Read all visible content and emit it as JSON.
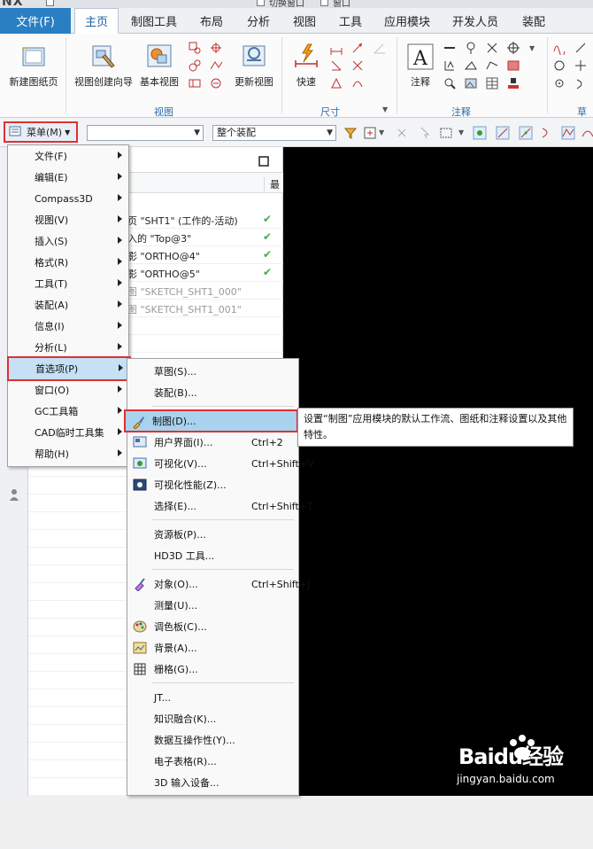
{
  "titlebar": {
    "app_logo": "NX",
    "items": [
      "切换窗口",
      "窗口"
    ]
  },
  "ribbon": {
    "file_tab": "文件(F)",
    "tabs": [
      "主页",
      "制图工具",
      "布局",
      "分析",
      "视图",
      "工具",
      "应用模块",
      "开发人员",
      "装配"
    ],
    "active_tab": "主页",
    "buttons": {
      "new_sheet": "新建图纸页",
      "view_wizard": "视图创建向导",
      "base_view": "基本视图",
      "update_view": "更新视图",
      "quick": "快速",
      "annotation": "注释"
    },
    "groups": {
      "view": "视图",
      "dimension": "尺寸",
      "annotation": "注释",
      "sketch": "草图"
    }
  },
  "commandbar": {
    "menu_button": "菜单(M)",
    "filter_combo": "",
    "assembly_combo": "整个装配"
  },
  "navigator": {
    "rows": [
      {
        "text": "页 \"SHT1\" (工作的-活动)",
        "check": true,
        "dim": false
      },
      {
        "text": "入的 \"Top@3\"",
        "check": true,
        "dim": false
      },
      {
        "text": "影 \"ORTHO@4\"",
        "check": true,
        "dim": false
      },
      {
        "text": "影 \"ORTHO@5\"",
        "check": true,
        "dim": false
      },
      {
        "text": "图 \"SKETCH_SHT1_000\"",
        "check": false,
        "dim": true
      },
      {
        "text": "图 \"SKETCH_SHT1_001\"",
        "check": false,
        "dim": true
      }
    ],
    "column_header": "最"
  },
  "mainmenu": {
    "items": [
      {
        "label": "文件(F)",
        "submenu": true
      },
      {
        "label": "编辑(E)",
        "submenu": true
      },
      {
        "label": "Compass3D",
        "submenu": true
      },
      {
        "label": "视图(V)",
        "submenu": true
      },
      {
        "label": "插入(S)",
        "submenu": true
      },
      {
        "label": "格式(R)",
        "submenu": true
      },
      {
        "label": "工具(T)",
        "submenu": true
      },
      {
        "label": "装配(A)",
        "submenu": true
      },
      {
        "label": "信息(I)",
        "submenu": true
      },
      {
        "label": "分析(L)",
        "submenu": true
      },
      {
        "label": "首选项(P)",
        "submenu": true,
        "highlight": true
      },
      {
        "label": "窗口(O)",
        "submenu": true
      },
      {
        "label": "GC工具箱",
        "submenu": true
      },
      {
        "label": "CAD临时工具集",
        "submenu": true
      },
      {
        "label": "帮助(H)",
        "submenu": true
      }
    ]
  },
  "submenu": {
    "items": [
      {
        "label": "草图(S)...",
        "shortcut": "",
        "icon": ""
      },
      {
        "label": "装配(B)...",
        "shortcut": "",
        "icon": ""
      },
      {
        "label": "制图(D)...",
        "shortcut": "",
        "icon": "drafting-brush-icon",
        "highlight": true
      },
      {
        "label": "用户界面(I)...",
        "shortcut": "Ctrl+2",
        "icon": "user-interface-icon"
      },
      {
        "label": "可视化(V)...",
        "shortcut": "Ctrl+Shift+V",
        "icon": "visualization-icon"
      },
      {
        "label": "可视化性能(Z)...",
        "shortcut": "",
        "icon": "visualization-performance-icon"
      },
      {
        "label": "选择(E)...",
        "shortcut": "Ctrl+Shift+T",
        "icon": ""
      },
      {
        "label": "资源板(P)...",
        "shortcut": "",
        "icon": ""
      },
      {
        "label": "HD3D 工具...",
        "shortcut": "",
        "icon": ""
      },
      {
        "label": "对象(O)...",
        "shortcut": "Ctrl+Shift+J",
        "icon": "object-icon"
      },
      {
        "label": "测量(U)...",
        "shortcut": "",
        "icon": ""
      },
      {
        "label": "调色板(C)...",
        "shortcut": "",
        "icon": "palette-icon"
      },
      {
        "label": "背景(A)...",
        "shortcut": "",
        "icon": "background-icon"
      },
      {
        "label": "栅格(G)...",
        "shortcut": "",
        "icon": "grid-icon"
      },
      {
        "label": "JT...",
        "shortcut": "",
        "icon": ""
      },
      {
        "label": "知识融合(K)...",
        "shortcut": "",
        "icon": ""
      },
      {
        "label": "数据互操作性(Y)...",
        "shortcut": "",
        "icon": ""
      },
      {
        "label": "电子表格(R)...",
        "shortcut": "",
        "icon": ""
      },
      {
        "label": "3D 输入设备...",
        "shortcut": "",
        "icon": ""
      }
    ]
  },
  "tooltip": {
    "text": "设置“制图”应用模块的默认工作流、图纸和注释设置以及其他特性。"
  },
  "watermark": {
    "brand": "Baidu经验",
    "url": "jingyan.baidu.com"
  },
  "colors": {
    "accent": "#2a7fc2",
    "highlight_border": "#e03030",
    "menu_highlight": "#c6e0f5",
    "graphics_bg": "#000000"
  }
}
